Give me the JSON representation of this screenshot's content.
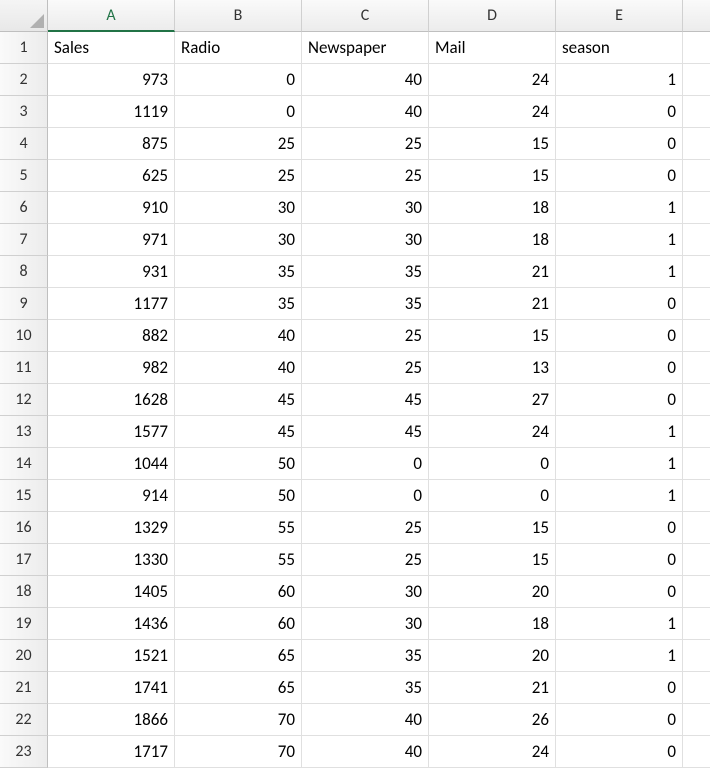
{
  "columns": [
    "A",
    "B",
    "C",
    "D",
    "E"
  ],
  "headers": [
    "Sales",
    "Radio",
    "Newspaper",
    "Mail",
    "season"
  ],
  "active_column": "A",
  "rows": [
    {
      "n": 2,
      "v": [
        973,
        0,
        40,
        24,
        1
      ]
    },
    {
      "n": 3,
      "v": [
        1119,
        0,
        40,
        24,
        0
      ]
    },
    {
      "n": 4,
      "v": [
        875,
        25,
        25,
        15,
        0
      ]
    },
    {
      "n": 5,
      "v": [
        625,
        25,
        25,
        15,
        0
      ]
    },
    {
      "n": 6,
      "v": [
        910,
        30,
        30,
        18,
        1
      ]
    },
    {
      "n": 7,
      "v": [
        971,
        30,
        30,
        18,
        1
      ]
    },
    {
      "n": 8,
      "v": [
        931,
        35,
        35,
        21,
        1
      ]
    },
    {
      "n": 9,
      "v": [
        1177,
        35,
        35,
        21,
        0
      ]
    },
    {
      "n": 10,
      "v": [
        882,
        40,
        25,
        15,
        0
      ]
    },
    {
      "n": 11,
      "v": [
        982,
        40,
        25,
        13,
        0
      ]
    },
    {
      "n": 12,
      "v": [
        1628,
        45,
        45,
        27,
        0
      ]
    },
    {
      "n": 13,
      "v": [
        1577,
        45,
        45,
        24,
        1
      ]
    },
    {
      "n": 14,
      "v": [
        1044,
        50,
        0,
        0,
        1
      ]
    },
    {
      "n": 15,
      "v": [
        914,
        50,
        0,
        0,
        1
      ]
    },
    {
      "n": 16,
      "v": [
        1329,
        55,
        25,
        15,
        0
      ]
    },
    {
      "n": 17,
      "v": [
        1330,
        55,
        25,
        15,
        0
      ]
    },
    {
      "n": 18,
      "v": [
        1405,
        60,
        30,
        20,
        0
      ]
    },
    {
      "n": 19,
      "v": [
        1436,
        60,
        30,
        18,
        1
      ]
    },
    {
      "n": 20,
      "v": [
        1521,
        65,
        35,
        20,
        1
      ]
    },
    {
      "n": 21,
      "v": [
        1741,
        65,
        35,
        21,
        0
      ]
    },
    {
      "n": 22,
      "v": [
        1866,
        70,
        40,
        26,
        0
      ]
    },
    {
      "n": 23,
      "v": [
        1717,
        70,
        40,
        24,
        0
      ]
    }
  ]
}
